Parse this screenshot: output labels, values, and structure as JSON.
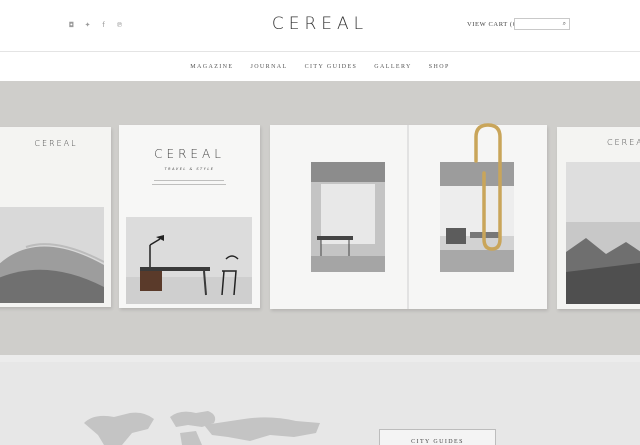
{
  "brand": {
    "logo": "CEREAL"
  },
  "header": {
    "social_icons": [
      "instagram-icon",
      "twitter-icon",
      "facebook-icon",
      "pinterest-icon"
    ],
    "social_glyphs": [
      "◘",
      "✦",
      "f",
      "℗"
    ],
    "cart_label": "VIEW CART (0)",
    "search_placeholder": ""
  },
  "nav": {
    "items": [
      "MAGAZINE",
      "JOURNAL",
      "CITY GUIDES",
      "GALLERY",
      "SHOP"
    ]
  },
  "hero": {
    "cover_left_title": "CEREAL",
    "cover_main_title": "CEREAL",
    "cover_main_subtitle": "TRAVEL & STYLE",
    "cover_right_title": "CEREAL"
  },
  "city_guides": {
    "label": "CITY GUIDES"
  },
  "colors": {
    "hero_bg": "#cfcecb",
    "paper": "#f4f4f2",
    "gold_clip": "#c9a55a"
  }
}
